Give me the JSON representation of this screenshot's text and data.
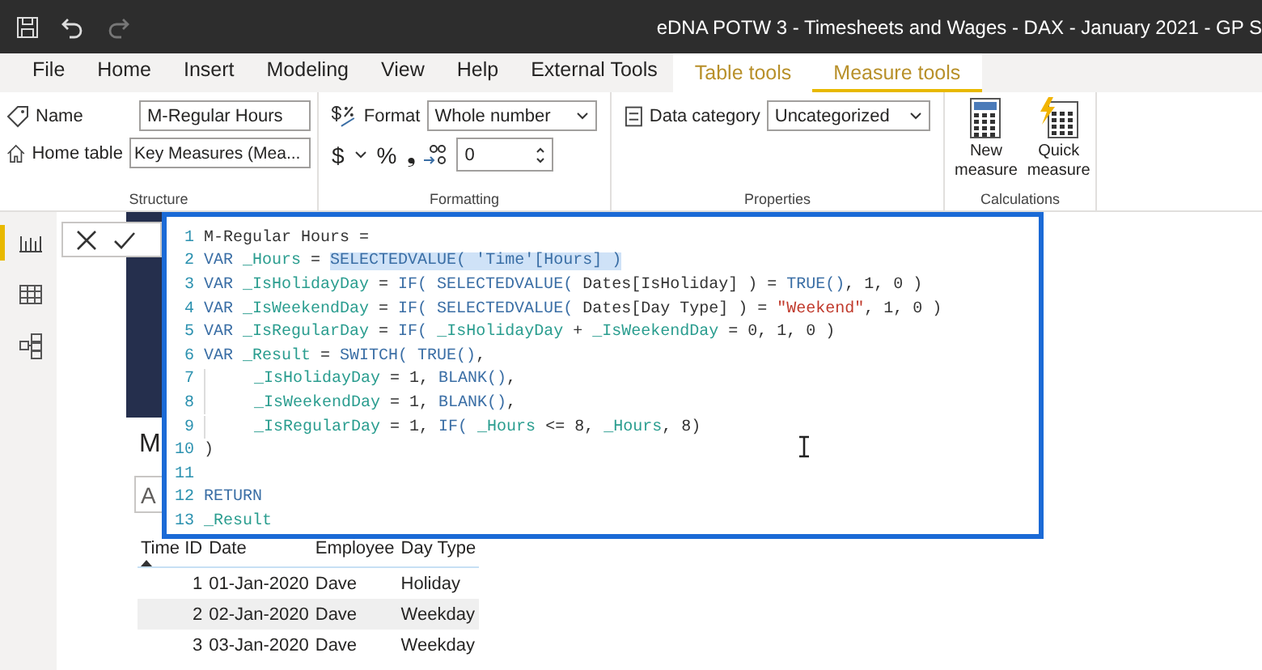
{
  "window": {
    "title": "eDNA POTW 3 - Timesheets and Wages - DAX - January 2021 - GP S"
  },
  "tabs": [
    {
      "label": "File",
      "kind": "standard",
      "selected": false
    },
    {
      "label": "Home",
      "kind": "standard",
      "selected": false
    },
    {
      "label": "Insert",
      "kind": "standard",
      "selected": false
    },
    {
      "label": "Modeling",
      "kind": "standard",
      "selected": false
    },
    {
      "label": "View",
      "kind": "standard",
      "selected": false
    },
    {
      "label": "Help",
      "kind": "standard",
      "selected": false
    },
    {
      "label": "External Tools",
      "kind": "standard",
      "selected": false
    },
    {
      "label": "Table tools",
      "kind": "contextual",
      "selected": false
    },
    {
      "label": "Measure tools",
      "kind": "contextual",
      "selected": true
    }
  ],
  "ribbon": {
    "structure": {
      "name_label": "Name",
      "name_value": "M-Regular Hours",
      "home_table_label": "Home table",
      "home_table_value": "Key Measures (Mea...",
      "group_label": "Structure"
    },
    "formatting": {
      "format_label": "Format",
      "format_value": "Whole number",
      "currency_symbol": "$",
      "percent_symbol": "%",
      "comma_symbol": "❟",
      "decimals_value": "0",
      "group_label": "Formatting"
    },
    "properties": {
      "data_category_label": "Data category",
      "data_category_value": "Uncategorized",
      "group_label": "Properties"
    },
    "calculations": {
      "buttons": [
        {
          "label": "New measure",
          "kind": "new"
        },
        {
          "label": "Quick measure",
          "kind": "quick"
        }
      ],
      "group_label": "Calculations"
    }
  },
  "view_rail": [
    {
      "kind": "report",
      "selected": true
    },
    {
      "kind": "data",
      "selected": false
    },
    {
      "kind": "model",
      "selected": false
    }
  ],
  "editor": {
    "lines": [
      {
        "number": "1",
        "tokens": [
          {
            "text": "M-Regular Hours =",
            "kind": "plain"
          }
        ]
      },
      {
        "number": "2",
        "tokens": [
          {
            "text": "VAR ",
            "kind": "kw"
          },
          {
            "text": "_Hours",
            "kind": "var"
          },
          {
            "text": " = ",
            "kind": "plain"
          },
          {
            "text": "SELECTEDVALUE( 'Time'[Hours] )",
            "kind": "sel"
          }
        ]
      },
      {
        "number": "3",
        "tokens": [
          {
            "text": "VAR ",
            "kind": "kw"
          },
          {
            "text": "_IsHolidayDay",
            "kind": "var"
          },
          {
            "text": " = ",
            "kind": "plain"
          },
          {
            "text": "IF( SELECTEDVALUE(",
            "kind": "fn"
          },
          {
            "text": " Dates[IsHoliday] ) = ",
            "kind": "plain"
          },
          {
            "text": "TRUE()",
            "kind": "fn"
          },
          {
            "text": ", 1, 0 )",
            "kind": "plain"
          }
        ]
      },
      {
        "number": "4",
        "tokens": [
          {
            "text": "VAR ",
            "kind": "kw"
          },
          {
            "text": "_IsWeekendDay",
            "kind": "var"
          },
          {
            "text": " = ",
            "kind": "plain"
          },
          {
            "text": "IF( SELECTEDVALUE(",
            "kind": "fn"
          },
          {
            "text": " Dates[Day Type] ) = ",
            "kind": "plain"
          },
          {
            "text": "\"Weekend\"",
            "kind": "str"
          },
          {
            "text": ", 1, 0 )",
            "kind": "plain"
          }
        ]
      },
      {
        "number": "5",
        "tokens": [
          {
            "text": "VAR ",
            "kind": "kw"
          },
          {
            "text": "_IsRegularDay",
            "kind": "var"
          },
          {
            "text": " = ",
            "kind": "plain"
          },
          {
            "text": "IF( ",
            "kind": "fn"
          },
          {
            "text": "_IsHolidayDay",
            "kind": "var"
          },
          {
            "text": " + ",
            "kind": "plain"
          },
          {
            "text": "_IsWeekendDay",
            "kind": "var"
          },
          {
            "text": " = 0, 1, 0 )",
            "kind": "plain"
          }
        ]
      },
      {
        "number": "6",
        "tokens": [
          {
            "text": "VAR ",
            "kind": "kw"
          },
          {
            "text": "_Result",
            "kind": "var"
          },
          {
            "text": " = ",
            "kind": "plain"
          },
          {
            "text": "SWITCH( TRUE()",
            "kind": "fn"
          },
          {
            "text": ",",
            "kind": "plain"
          }
        ]
      },
      {
        "number": "7",
        "indent": true,
        "tokens": [
          {
            "text": "_IsHolidayDay",
            "kind": "var"
          },
          {
            "text": " = 1, ",
            "kind": "plain"
          },
          {
            "text": "BLANK()",
            "kind": "fn"
          },
          {
            "text": ",",
            "kind": "plain"
          }
        ]
      },
      {
        "number": "8",
        "indent": true,
        "tokens": [
          {
            "text": "_IsWeekendDay",
            "kind": "var"
          },
          {
            "text": " = 1, ",
            "kind": "plain"
          },
          {
            "text": "BLANK()",
            "kind": "fn"
          },
          {
            "text": ",",
            "kind": "plain"
          }
        ]
      },
      {
        "number": "9",
        "indent": true,
        "tokens": [
          {
            "text": "_IsRegularDay",
            "kind": "var"
          },
          {
            "text": " = 1, ",
            "kind": "plain"
          },
          {
            "text": "IF( ",
            "kind": "fn"
          },
          {
            "text": "_Hours",
            "kind": "var"
          },
          {
            "text": " <= 8, ",
            "kind": "plain"
          },
          {
            "text": "_Hours",
            "kind": "var"
          },
          {
            "text": ", 8)",
            "kind": "plain"
          }
        ]
      },
      {
        "number": "10",
        "tokens": [
          {
            "text": ")",
            "kind": "plain"
          }
        ]
      },
      {
        "number": "11"
      },
      {
        "number": "12",
        "tokens": [
          {
            "text": "RETURN",
            "kind": "kw"
          }
        ]
      },
      {
        "number": "13",
        "tokens": [
          {
            "text": "_Result",
            "kind": "var"
          }
        ]
      }
    ]
  },
  "visual": {
    "title": "M",
    "field_text": "A"
  },
  "table": {
    "columns": [
      "Time ID",
      "Date",
      "Employee",
      "Day Type"
    ],
    "rows": [
      [
        "1",
        "01-Jan-2020",
        "Dave",
        "Holiday"
      ],
      [
        "2",
        "02-Jan-2020",
        "Dave",
        "Weekday"
      ],
      [
        "3",
        "03-Jan-2020",
        "Dave",
        "Weekday"
      ]
    ]
  }
}
